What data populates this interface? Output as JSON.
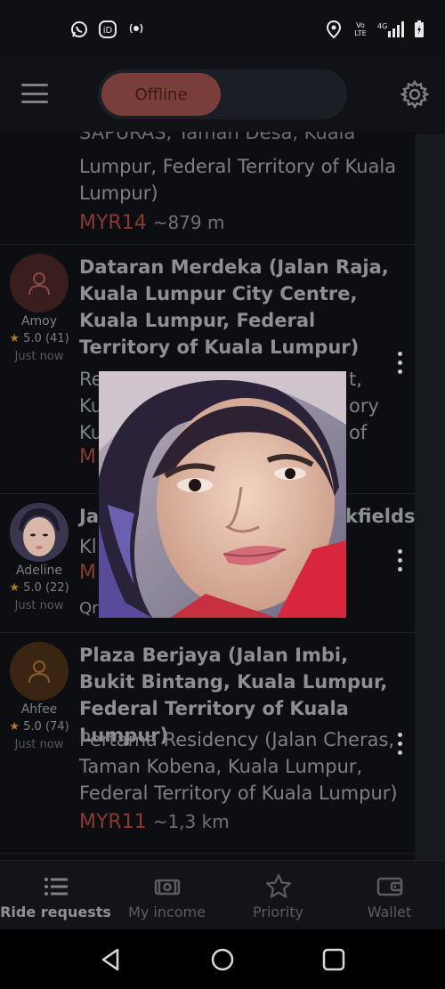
{
  "status_bar": {
    "left_icons": [
      "whatsapp-icon",
      "indrive-icon",
      "location-broadcast-icon"
    ],
    "right_icons": [
      "location-pin-icon",
      "volte-icon",
      "signal-4g-icon",
      "battery-icon"
    ],
    "volte_text": "Vo LTE",
    "network_text": "4G"
  },
  "app_bar": {
    "status_toggle": "Offline",
    "colors": {
      "offline_knob": "#7a3e3a"
    }
  },
  "requests": [
    {
      "from": "",
      "to_partial": "SAPURAS, Taman Desa, Kuala Lumpur, Federal Territory of Kuala Lumpur)",
      "to_visible": "Lumpur, Federal Territory of Kuala Lumpur)",
      "to_top": "SAPURAS, Taman Desa, Kuala",
      "price": "MYR14",
      "distance": "~879 m"
    },
    {
      "user": "Amoy",
      "rating": "5.0",
      "rating_count": "(41)",
      "time": "Just now",
      "from": "Dataran Merdeka (Jalan Raja, Kuala Lumpur City Centre, Kuala Lumpur, Federal Territory of Kuala Lumpur)",
      "to_lines": [
        "Re",
        "Ku",
        "Ku"
      ],
      "to_right_lines": [
        "t,",
        "ory of"
      ],
      "price": "M"
    },
    {
      "user": "Adeline",
      "rating": "5.0",
      "rating_count": "(22)",
      "time": "Just now",
      "from_left": "Ja",
      "from_right": "kfields)",
      "to_left": "Kl",
      "price": "M",
      "extra": "Qr"
    },
    {
      "user": "Ahfee",
      "rating": "5.0",
      "rating_count": "(74)",
      "time": "Just now",
      "from": "Plaza Berjaya (Jalan Imbi, Bukit Bintang, Kuala Lumpur, Federal Territory of Kuala Lumpur)",
      "to": "Pertama Residency (Jalan Cheras, Taman Kobena, Kuala Lumpur, Federal Territory of Kuala Lumpur)",
      "price": "MYR11",
      "distance": "~1,3 km"
    }
  ],
  "bottom_nav": [
    {
      "label": "Ride requests",
      "icon": "list-icon",
      "active": true
    },
    {
      "label": "My income",
      "icon": "cash-icon",
      "active": false
    },
    {
      "label": "Priority",
      "icon": "star-icon",
      "active": false
    },
    {
      "label": "Wallet",
      "icon": "wallet-icon",
      "active": false
    }
  ],
  "system_nav": [
    "back-icon",
    "home-icon",
    "recents-icon"
  ]
}
